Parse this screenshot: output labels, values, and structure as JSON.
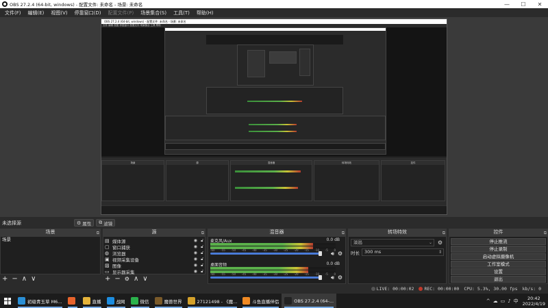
{
  "window": {
    "title": "OBS 27.2.4 (64-bit, windows) - 配置文件: 未命名 - 场景: 未命名"
  },
  "menu": [
    "文件(F)",
    "编辑(E)",
    "视图(V)",
    "停靠窗口(D)",
    "配置文件(P)",
    "场景集合(S)",
    "工具(T)",
    "帮助(H)"
  ],
  "menu_disabled": [
    4
  ],
  "nested_preview": {
    "title": "OBS 27.2.4 (64-bit, windows) - 配置文件: 未命名 - 场景: 未命名",
    "menu": "文件  编辑  视图  停靠窗口  配置文件  场景集合  工具  帮助"
  },
  "scene_bar": {
    "label": "未选择源",
    "properties": "属性",
    "filters": "滤镜"
  },
  "scenes": {
    "header": "场景",
    "items": [
      "场景"
    ]
  },
  "sources": {
    "header": "源",
    "items": [
      {
        "icon": "media-icon",
        "name": "媒体源"
      },
      {
        "icon": "window-icon",
        "name": "窗口捕获"
      },
      {
        "icon": "browser-icon",
        "name": "浏览器"
      },
      {
        "icon": "camera-icon",
        "name": "视频采集设备"
      },
      {
        "icon": "image-icon",
        "name": "图像"
      },
      {
        "icon": "monitor-icon",
        "name": "显示器采集"
      }
    ]
  },
  "mixer": {
    "header": "混音器",
    "channels": [
      {
        "name": "麦克风/Aux",
        "db": "0.0 dB",
        "level": 0.82
      },
      {
        "name": "桌面音频",
        "db": "0.0 dB",
        "level": 0.78
      }
    ],
    "ticks": [
      "-60",
      "-55",
      "-50",
      "-45",
      "-40",
      "-35",
      "-30",
      "-25",
      "-20",
      "-15",
      "-10",
      "-5",
      "0"
    ]
  },
  "transitions": {
    "header": "转场特效",
    "type": "淡出",
    "duration_label": "时长",
    "duration": "300 ms"
  },
  "controls": {
    "header": "控件",
    "buttons": [
      "停止推流",
      "停止录制",
      "启动虚拟摄像机",
      "工作室模式",
      "设置",
      "退出"
    ]
  },
  "status": {
    "live": "LIVE: 00:00:02",
    "rec": "REC: 00:00:00",
    "cpu": "CPU: 5.3%, 30.00 fps",
    "kbps": "kb/s: 0"
  },
  "taskbar": {
    "apps": [
      {
        "label": "初级青玉草 M6...",
        "color": "#2a8fd6"
      },
      {
        "label": "",
        "color": "#e8632b"
      },
      {
        "label": "直播",
        "color": "#e5b33a"
      },
      {
        "label": "战网",
        "color": "#1d8de0"
      },
      {
        "label": "微信",
        "color": "#2bb24c"
      },
      {
        "label": "魔兽世界",
        "color": "#7a5a2a"
      },
      {
        "label": "27121498 - 《魔...",
        "color": "#d4a12a"
      },
      {
        "label": "斗鱼直播伴侣",
        "color": "#f08a24"
      },
      {
        "label": "OBS 27.2.4 (64-...",
        "color": "#222222"
      }
    ],
    "tray": [
      "^",
      "☁",
      "▭",
      "♪",
      "中"
    ],
    "time": "20:42",
    "date": "2022/4/19"
  },
  "colors": {
    "accent": "#4a7bd8",
    "meter_green": "#5ab04a",
    "meter_yellow": "#c9c334",
    "meter_red": "#b53a2d"
  }
}
